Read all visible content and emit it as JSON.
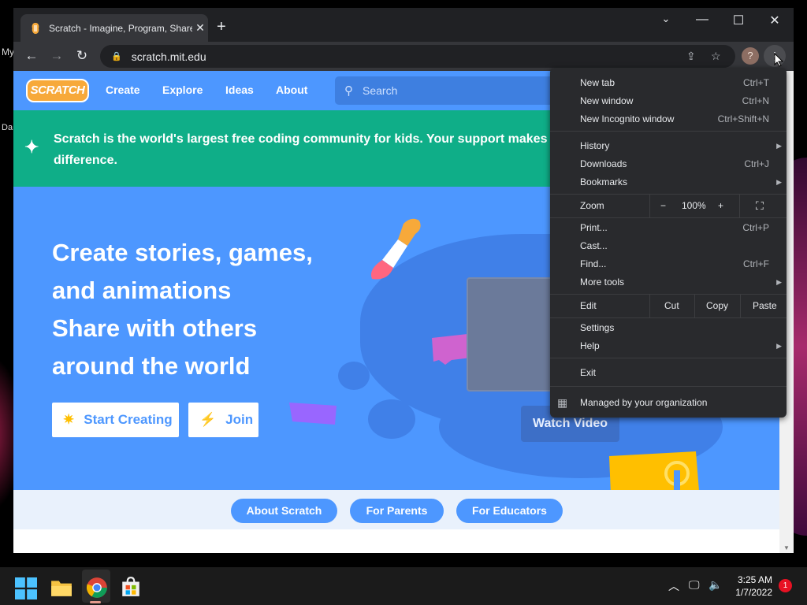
{
  "desktop": {
    "labels": [
      "My",
      "Da"
    ]
  },
  "browser": {
    "tab_title": "Scratch - Imagine, Program, Share",
    "new_tab_icon": "+",
    "url": "scratch.mit.edu",
    "profile_initial": "?",
    "window_controls": {
      "minimize": "—",
      "maximize": "☐",
      "close": "✕",
      "tab_list": "⌄"
    }
  },
  "site": {
    "logo": "SCRATCH",
    "nav": [
      "Create",
      "Explore",
      "Ideas",
      "About"
    ],
    "search_placeholder": "Search",
    "banner_text": "Scratch is the world's largest free coding community for kids. Your support makes a difference.",
    "hero_lines": [
      "Create stories, games,",
      "and animations",
      "Share with others",
      "around the world"
    ],
    "start_creating": "Start Creating",
    "join": "Join",
    "watch_video": "Watch Video",
    "subnav": [
      "About Scratch",
      "For Parents",
      "For Educators"
    ]
  },
  "menu": {
    "items": [
      {
        "label": "New tab",
        "shortcut": "Ctrl+T"
      },
      {
        "label": "New window",
        "shortcut": "Ctrl+N"
      },
      {
        "label": "New Incognito window",
        "shortcut": "Ctrl+Shift+N"
      },
      {
        "label": "History",
        "submenu": true
      },
      {
        "label": "Downloads",
        "shortcut": "Ctrl+J"
      },
      {
        "label": "Bookmarks",
        "submenu": true
      },
      {
        "label": "Print...",
        "shortcut": "Ctrl+P"
      },
      {
        "label": "Cast..."
      },
      {
        "label": "Find...",
        "shortcut": "Ctrl+F"
      },
      {
        "label": "More tools",
        "submenu": true
      },
      {
        "label": "Settings"
      },
      {
        "label": "Help",
        "submenu": true
      },
      {
        "label": "Exit"
      }
    ],
    "zoom": {
      "label": "Zoom",
      "minus": "−",
      "value": "100%",
      "plus": "+",
      "fullscreen_icon": "fullscreen-icon"
    },
    "edit": {
      "label": "Edit",
      "cut": "Cut",
      "copy": "Copy",
      "paste": "Paste"
    },
    "managed": "Managed by your organization"
  },
  "taskbar": {
    "time": "3:25 AM",
    "date": "1/7/2022",
    "notifications": "1",
    "apps": [
      "start-icon",
      "file-explorer-icon",
      "chrome-icon",
      "store-icon"
    ]
  },
  "colors": {
    "scratch_blue": "#4d97ff",
    "banner_green": "#0fae88",
    "chrome_dark": "#202124",
    "menu_bg": "#292a2d"
  }
}
